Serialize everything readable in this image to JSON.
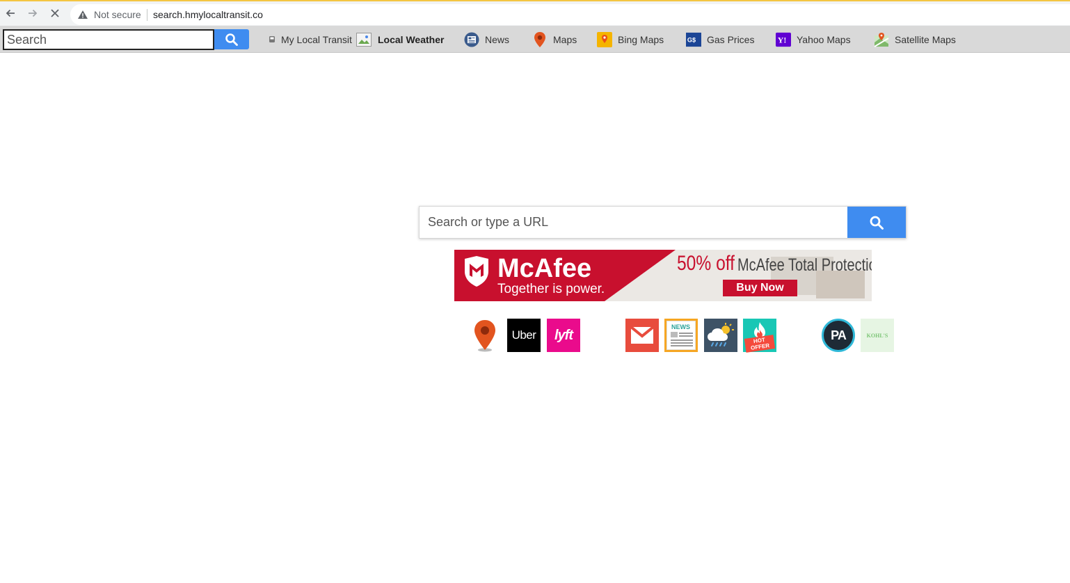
{
  "browser": {
    "security_label": "Not secure",
    "url": "search.hmylocaltransit.co"
  },
  "toolbar": {
    "search_placeholder": "Search",
    "items": [
      {
        "label": "My Local Transit",
        "icon": "transit-icon"
      },
      {
        "label": "Local Weather",
        "icon": "broken-image-icon"
      },
      {
        "label": "News",
        "icon": "news-icon"
      },
      {
        "label": "Maps",
        "icon": "map-pin-icon"
      },
      {
        "label": "Bing Maps",
        "icon": "bing-maps-icon"
      },
      {
        "label": "Gas Prices",
        "icon": "gas-prices-icon"
      },
      {
        "label": "Yahoo Maps",
        "icon": "yahoo-icon"
      },
      {
        "label": "Satellite Maps",
        "icon": "satellite-maps-icon"
      }
    ]
  },
  "main": {
    "search_placeholder": "Search or type a URL"
  },
  "banner": {
    "brand": "McAfee",
    "tagline": "Together is power.",
    "offer": "50% off",
    "product": "McAfee Total Protection",
    "cta": "Buy Now"
  },
  "shortcuts": [
    {
      "name": "maps",
      "icon": "map-pin-icon"
    },
    {
      "name": "uber",
      "label": "Uber"
    },
    {
      "name": "lyft",
      "label": "lyft"
    },
    {
      "name": "gmail",
      "icon": "mail-icon"
    },
    {
      "name": "news",
      "label": "NEWS"
    },
    {
      "name": "weather",
      "icon": "weather-icon"
    },
    {
      "name": "hot-offer",
      "label": "HOT OFFER"
    },
    {
      "name": "pa",
      "label": "PA"
    },
    {
      "name": "kohls",
      "label": "KOHL'S"
    }
  ],
  "colors": {
    "accent_blue": "#3f8cf0",
    "mcafee_red": "#c8102e",
    "uber_black": "#000000",
    "lyft_pink": "#ea0b8c",
    "gmail_red": "#e84c3d"
  }
}
